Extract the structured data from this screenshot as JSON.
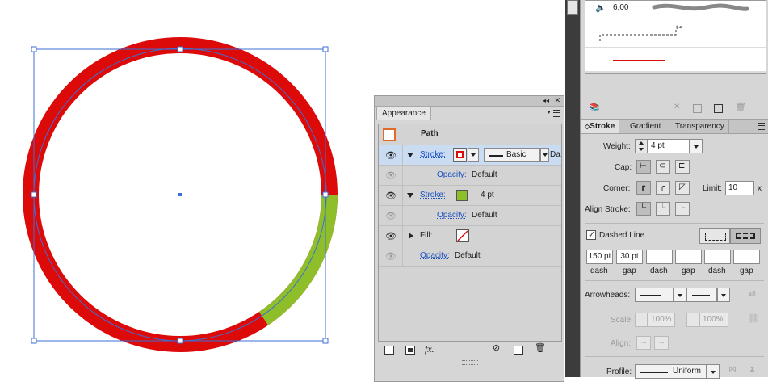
{
  "canvas": {
    "stroke_color": "#dd0a0a",
    "dash_color": "#8fbe2b",
    "selection_color": "#3d6fd6"
  },
  "appearance": {
    "tab_label": "Appearance",
    "header_label": "Path",
    "rows": [
      {
        "label": "Stroke:",
        "profile": "Basic",
        "extra": "Da..."
      },
      {
        "label": "Opacity:",
        "value": "Default"
      },
      {
        "label": "Stroke:",
        "weight": "4 pt"
      },
      {
        "label": "Opacity:",
        "value": "Default"
      },
      {
        "label": "Fill:"
      },
      {
        "label": "Opacity:",
        "value": "Default"
      }
    ],
    "fx_label": "fx."
  },
  "brushes": {
    "size_value": "6,00"
  },
  "stroke_panel": {
    "tabs": [
      "Stroke",
      "Gradient",
      "Transparency"
    ],
    "weight_label": "Weight:",
    "weight_value": "4 pt",
    "cap_label": "Cap:",
    "corner_label": "Corner:",
    "limit_label": "Limit:",
    "limit_value": "10",
    "limit_suffix": "x",
    "align_label": "Align Stroke:",
    "dashed_label": "Dashed Line",
    "dash_values": [
      "150 pt",
      "30 pt",
      "",
      "",
      "",
      ""
    ],
    "dash_labels": [
      "dash",
      "gap",
      "dash",
      "gap",
      "dash",
      "gap"
    ],
    "arrowheads_label": "Arrowheads:",
    "scale_label": "Scale:",
    "scale_values": [
      "100%",
      "100%"
    ],
    "align_arrow_label": "Align:",
    "profile_label": "Profile:",
    "profile_value": "Uniform"
  }
}
